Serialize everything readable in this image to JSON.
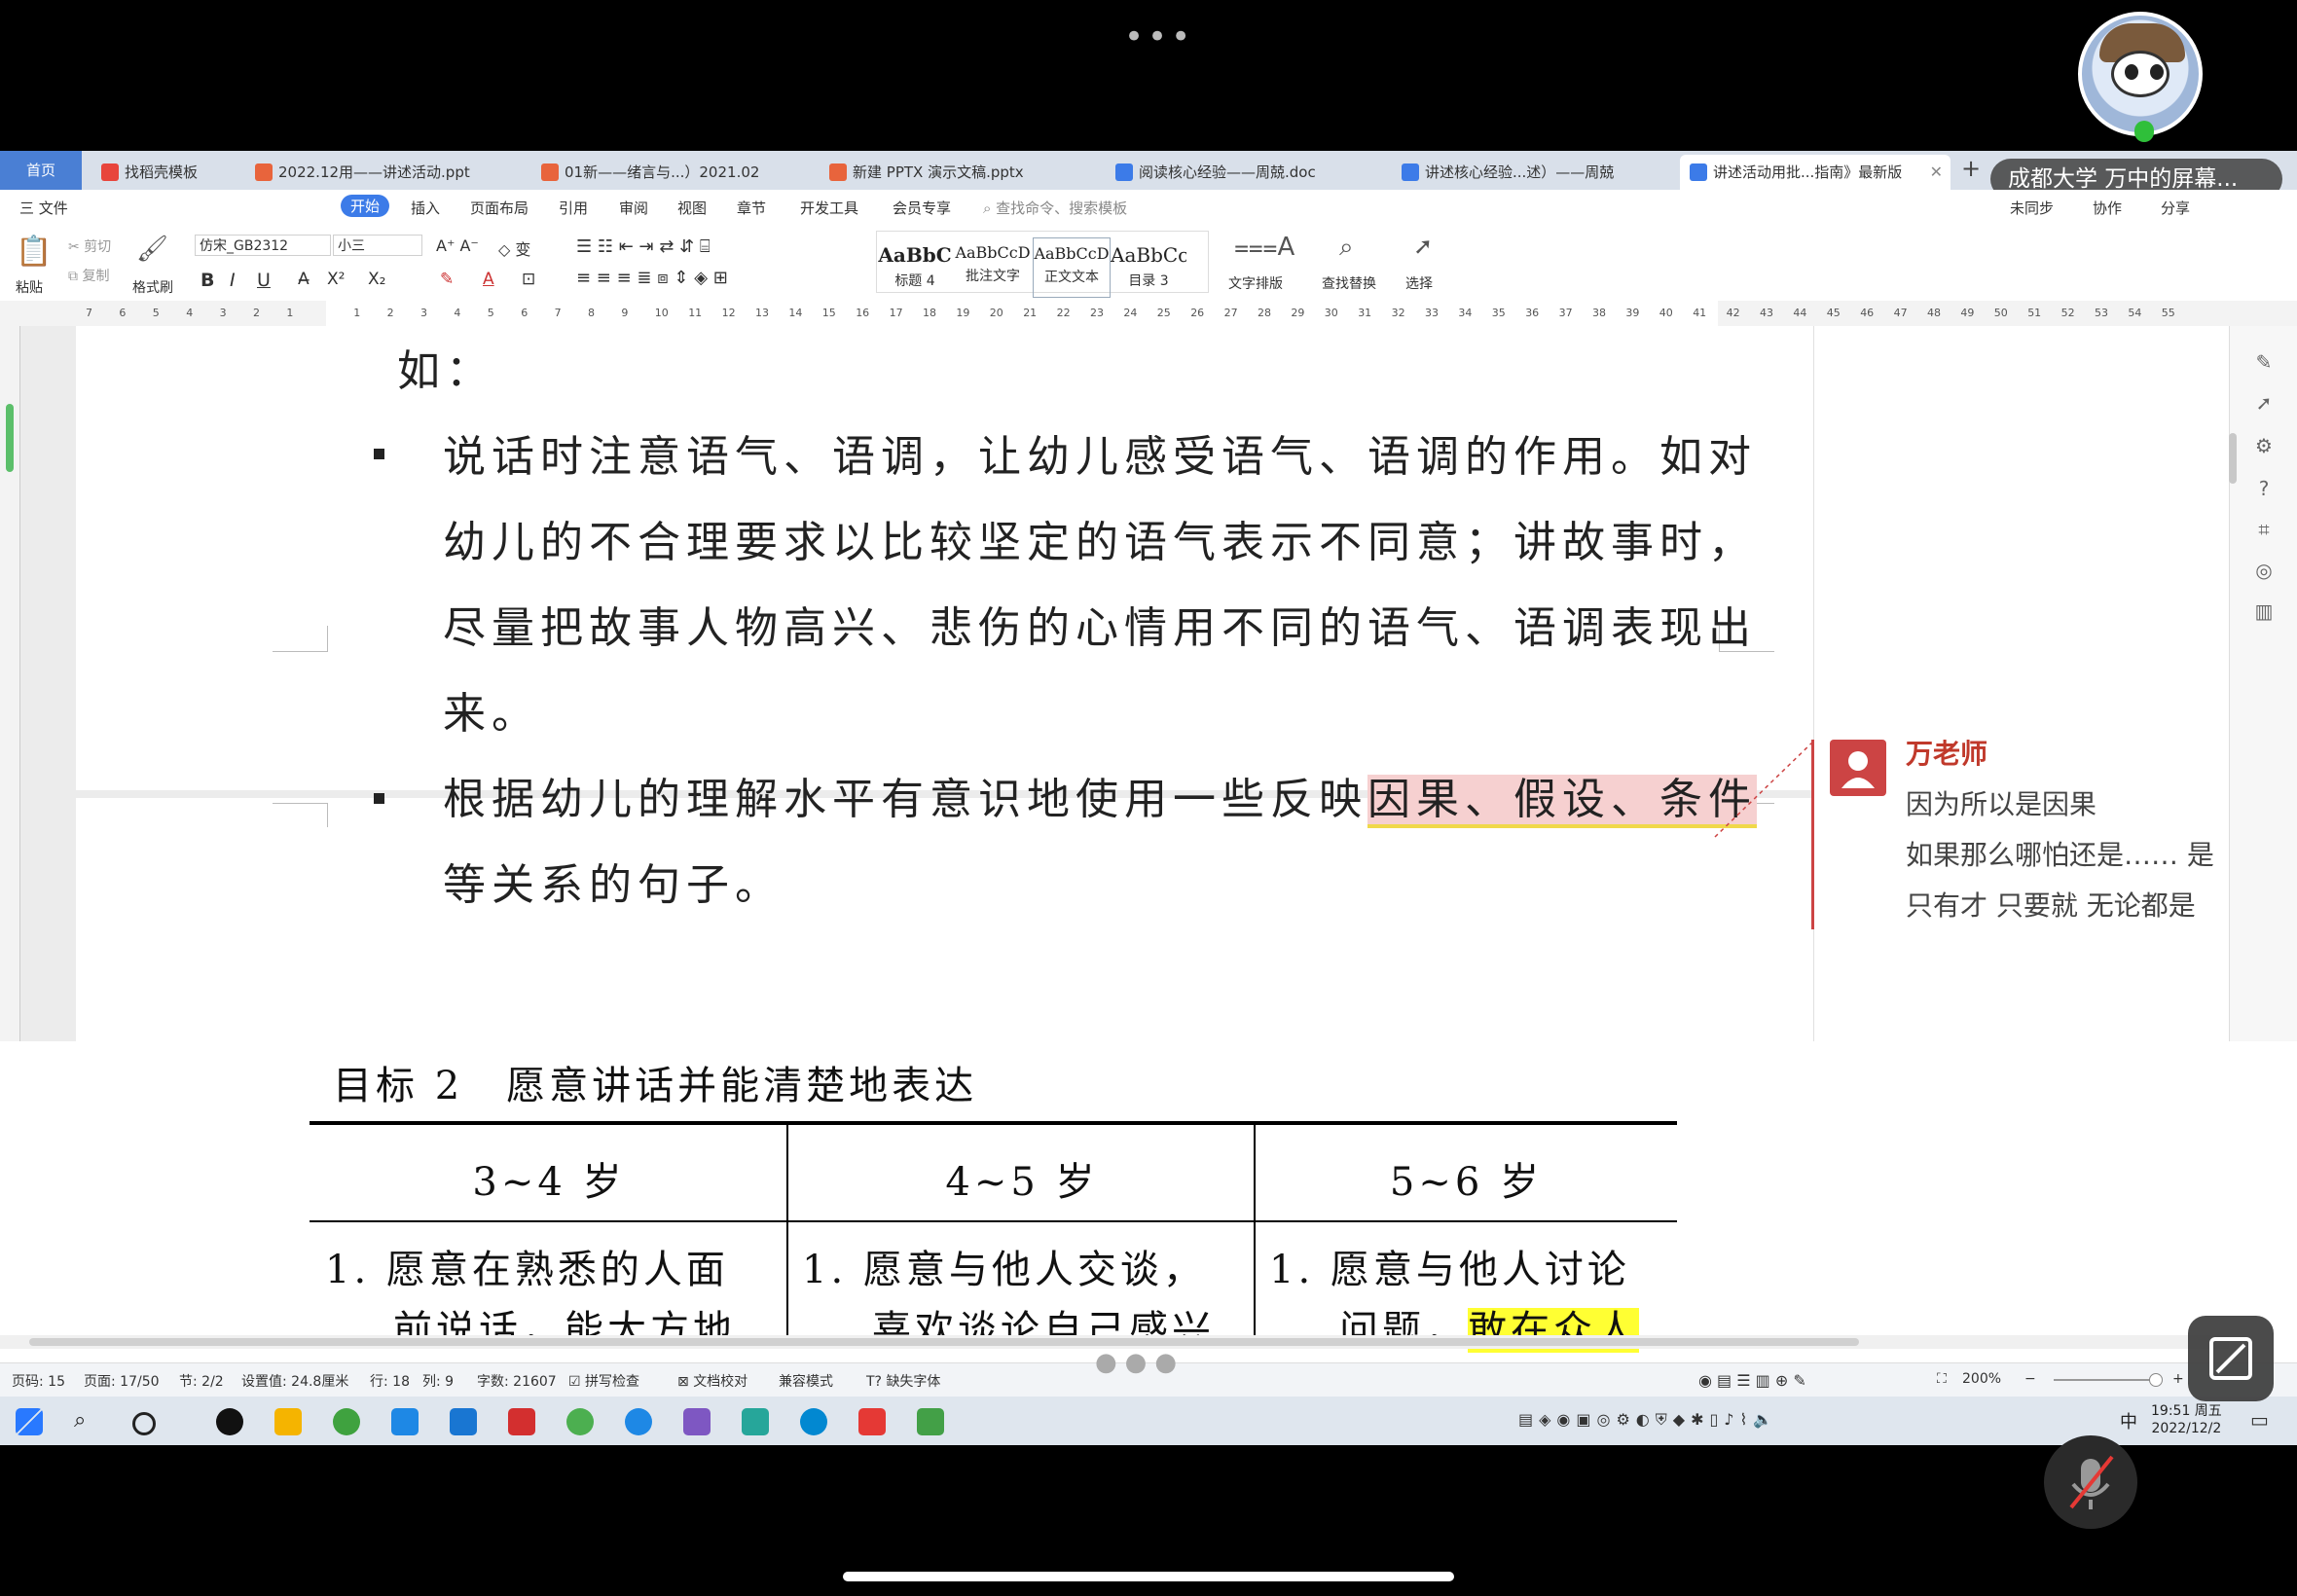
{
  "tabs": [
    {
      "label": "首页",
      "type": "home"
    },
    {
      "label": "找稻壳模板",
      "color": "#e8453c"
    },
    {
      "label": "2022.12用——讲述活动.ppt",
      "color": "#e8643c"
    },
    {
      "label": "01新——绪言与...）2021.02",
      "color": "#e8643c"
    },
    {
      "label": "新建 PPTX 演示文稿.pptx",
      "color": "#e8643c"
    },
    {
      "label": "阅读核心经验——周兢.doc",
      "color": "#3c7be8"
    },
    {
      "label": "讲述核心经验...述）——周兢",
      "color": "#3c7be8"
    },
    {
      "label": "讲述活动用批...指南》最新版",
      "color": "#3c7be8",
      "active": true
    }
  ],
  "share_overlay": "成都大学 万中的屏幕...",
  "menu": {
    "file": "三 文件",
    "items": [
      "开始",
      "插入",
      "页面布局",
      "引用",
      "审阅",
      "视图",
      "章节",
      "开发工具",
      "会员专享"
    ],
    "active": "开始",
    "search_placeholder": "查找命令、搜索模板",
    "right": [
      "未同步",
      "协作",
      "分享"
    ]
  },
  "ribbon": {
    "paste": "粘贴",
    "cut": "剪切",
    "copy": "复制",
    "format_painter": "格式刷",
    "font_name": "仿宋_GB2312",
    "font_size": "小三",
    "styles": [
      {
        "preview": "AaBbC",
        "label": "标题 4"
      },
      {
        "preview": "AaBbCcD",
        "label": "批注文字"
      },
      {
        "preview": "AaBbCcD",
        "label": "正文文本"
      },
      {
        "preview": "AaBbCc",
        "label": "目录 3"
      }
    ],
    "text_layout": "文字排版",
    "find_replace": "查找替换",
    "select": "选择"
  },
  "ruler_numbers": [
    "7",
    "6",
    "5",
    "4",
    "3",
    "2",
    "1",
    "",
    "1",
    "2",
    "3",
    "4",
    "5",
    "6",
    "7",
    "8",
    "9",
    "10",
    "11",
    "12",
    "13",
    "14",
    "15",
    "16",
    "17",
    "18",
    "19",
    "20",
    "21",
    "22",
    "23",
    "24",
    "25",
    "26",
    "27",
    "28",
    "29",
    "30",
    "31",
    "32",
    "33",
    "34",
    "35",
    "36",
    "37",
    "38",
    "39",
    "40",
    "41",
    "42",
    "43",
    "44",
    "45",
    "46",
    "47",
    "48",
    "49",
    "50",
    "51",
    "52",
    "53",
    "54",
    "55"
  ],
  "doc": {
    "line_ru": "如：",
    "bullet1": [
      "说话时注意语气、语调，让幼儿感受语气、语调的作用。如对",
      "幼儿的不合理要求以比较坚定的语气表示不同意；讲故事时，",
      "尽量把故事人物高兴、悲伤的心情用不同的语气、语调表现出",
      "来。"
    ],
    "bullet2_pre": "根据幼儿的理解水平有意识地使用一些反映",
    "bullet2_hl": "因果、假设、条件",
    "bullet2_line2": "等关系的句子。",
    "heading2": "目标 2　愿意讲话并能清楚地表达",
    "table_headers": [
      "3~4 岁",
      "4~5 岁",
      "5~6 岁"
    ],
    "table_rows": [
      [
        "1.  愿意在熟悉的人面",
        "1.  愿意与他人交谈，",
        "1.  愿意与他人讨论"
      ],
      [
        "前说话，能大方地",
        "喜欢谈论自己感兴",
        "问题，"
      ]
    ],
    "row2_col3_hl": "敢在众人"
  },
  "comment": {
    "author": "万老师",
    "lines": [
      "因为所以是因果",
      "如果那么哪怕还是……  是",
      "只有才  只要就  无论都是"
    ]
  },
  "status": {
    "page_num": "页码: 15",
    "page": "页面: 17/50",
    "section": "节: 2/2",
    "setting": "设置值: 24.8厘米",
    "row": "行: 18",
    "col": "列: 9",
    "words": "字数: 21607",
    "spell": "拼写检查",
    "proof": "文档校对",
    "compat": "兼容模式",
    "missing_font": "缺失字体",
    "zoom": "200%"
  },
  "taskbar": {
    "time": "19:51 周五",
    "date": "2022/12/2",
    "ime": "中"
  },
  "colors": {
    "accent": "#3c7be8",
    "highlight_red": "#f6d0d0",
    "highlight_yellow": "#ffff33",
    "comment": "#c44444"
  }
}
